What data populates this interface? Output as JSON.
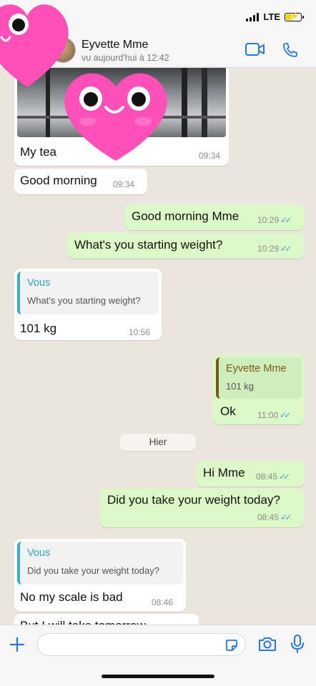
{
  "status_bar": {
    "network": "LTE"
  },
  "header": {
    "contact_name": "Eyvette Mme",
    "last_seen": "vu aujourd'hui à 12:42",
    "icons": [
      "video-call-icon",
      "voice-call-icon"
    ]
  },
  "messages": [
    {
      "id": "m1",
      "direction": "in",
      "type": "image",
      "caption": "My tea",
      "time": "09:34"
    },
    {
      "id": "m2",
      "direction": "in",
      "text": "Good morning",
      "time": "09:34"
    },
    {
      "id": "m3",
      "direction": "out",
      "text": "Good morning Mme",
      "time": "10:29",
      "read": true
    },
    {
      "id": "m4",
      "direction": "out",
      "text": "What's you starting weight?",
      "time": "10:29",
      "read": true
    },
    {
      "id": "m5",
      "direction": "in",
      "quote": {
        "author": "Vous",
        "text": "What's you starting weight?"
      },
      "text": "101 kg",
      "time": "10:56"
    },
    {
      "id": "m6",
      "direction": "out",
      "quote": {
        "author": "Eyvette Mme",
        "text": "101 kg"
      },
      "text": "Ok",
      "time": "11:00",
      "read": true
    },
    {
      "id": "m7",
      "direction": "out",
      "text": "Hi Mme",
      "time": "08:45",
      "read": true
    },
    {
      "id": "m8",
      "direction": "out",
      "text": "Did you take your weight today?",
      "time": "08:45",
      "read": true
    },
    {
      "id": "m9",
      "direction": "in",
      "quote": {
        "author": "Vous",
        "text": "Did you take your weight today?"
      },
      "text": "No my scale is bad",
      "time": "08:46"
    },
    {
      "id": "m10",
      "direction": "in",
      "text": "But I will take tomorrow",
      "partial": true
    }
  ],
  "date_separator": "Hier",
  "composer": {
    "icons": [
      "plus-icon",
      "sticker-icon",
      "camera-icon",
      "microphone-icon"
    ]
  },
  "overlay": {
    "stickers": [
      "heart-face-sticker",
      "heart-face-sticker"
    ],
    "color": "#ff4fb8"
  },
  "colors": {
    "outgoing_bubble": "#dcf8c6",
    "incoming_bubble": "#ffffff",
    "accent": "#2a78d6",
    "read_ticks": "#4fa3e0"
  }
}
